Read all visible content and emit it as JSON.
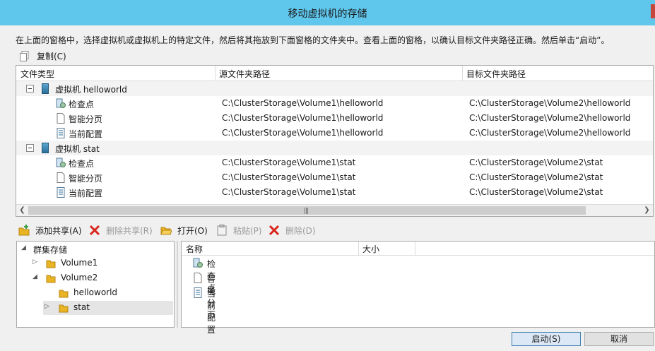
{
  "window": {
    "title": "移动虚拟机的存储"
  },
  "instruction": "在上面的窗格中，选择虚拟机或虚拟机上的特定文件，然后将其拖放到下面窗格的文件夹中。查看上面的窗格，以确认目标文件夹路径正确。然后单击“启动”。",
  "copy": {
    "label": "复制(C)"
  },
  "grid": {
    "columns": [
      "文件类型",
      "源文件夹路径",
      "目标文件夹路径"
    ],
    "groups": [
      {
        "label": "虚拟机 helloworld",
        "items": [
          {
            "type": "检查点",
            "icon": "checkpoint-icon",
            "source": "C:\\ClusterStorage\\Volume1\\helloworld",
            "target": "C:\\ClusterStorage\\Volume2\\helloworld"
          },
          {
            "type": "智能分页",
            "icon": "file-icon",
            "source": "C:\\ClusterStorage\\Volume1\\helloworld",
            "target": "C:\\ClusterStorage\\Volume2\\helloworld"
          },
          {
            "type": "当前配置",
            "icon": "config-icon",
            "source": "C:\\ClusterStorage\\Volume1\\helloworld",
            "target": "C:\\ClusterStorage\\Volume2\\helloworld"
          }
        ]
      },
      {
        "label": "虚拟机 stat",
        "items": [
          {
            "type": "检查点",
            "icon": "checkpoint-icon",
            "source": "C:\\ClusterStorage\\Volume1\\stat",
            "target": "C:\\ClusterStorage\\Volume2\\stat"
          },
          {
            "type": "智能分页",
            "icon": "file-icon",
            "source": "C:\\ClusterStorage\\Volume1\\stat",
            "target": "C:\\ClusterStorage\\Volume2\\stat"
          },
          {
            "type": "当前配置",
            "icon": "config-icon",
            "source": "C:\\ClusterStorage\\Volume1\\stat",
            "target": "C:\\ClusterStorage\\Volume2\\stat"
          }
        ]
      }
    ]
  },
  "toolbar": {
    "add_share": "添加共享(A)",
    "remove_share": "删除共享(R)",
    "open": "打开(O)",
    "paste": "粘贴(P)",
    "delete": "删除(D)"
  },
  "tree": {
    "root": "群集存储",
    "volume1": "Volume1",
    "volume2": "Volume2",
    "helloworld": "helloworld",
    "stat": "stat"
  },
  "files": {
    "columns": [
      "名称",
      "大小"
    ],
    "items": [
      "检查点",
      "智能分页",
      "当前配置"
    ]
  },
  "buttons": {
    "start": "启动(S)",
    "cancel": "取消"
  },
  "colors": {
    "titlebar": "#5fc6ec",
    "close": "#c7483b",
    "delete_red": "#d9261c",
    "folder_yellow": "#e8b423"
  }
}
